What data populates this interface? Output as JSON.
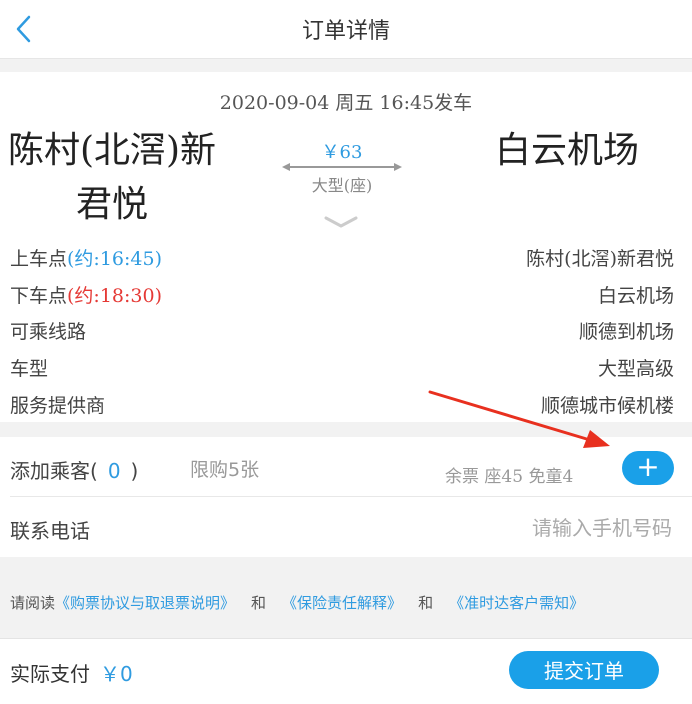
{
  "header": {
    "title": "订单详情"
  },
  "trip": {
    "departure": "2020-09-04 周五 16:45发车",
    "from": "陈村(北滘)新君悦",
    "to": "白云机场",
    "price": "￥63",
    "bus_type": "大型(座)"
  },
  "details": [
    {
      "label": "上车点",
      "note": "(约:16:45)",
      "value": "陈村(北滘)新君悦"
    },
    {
      "label": "下车点",
      "note": "(约:18:30)",
      "value": "白云机场"
    },
    {
      "label": "可乘线路",
      "value": "顺德到机场"
    },
    {
      "label": "车型",
      "value": "大型高级"
    },
    {
      "label": "服务提供商",
      "value": "顺德城市候机楼"
    }
  ],
  "passengers": {
    "label_open": "添加乘客(",
    "count": "0",
    "label_close": ")",
    "limit": "限购5张",
    "remaining": "余票 座45 免童4",
    "add_symbol": "+"
  },
  "contact": {
    "label": "联系电话",
    "placeholder": "请输入手机号码"
  },
  "agreement": {
    "prefix": "请阅读",
    "link1": "《购票协议与取退票说明》",
    "and": "和",
    "link2": "《保险责任解释》",
    "link3": "《准时达客户需知》"
  },
  "footer": {
    "pay_label": "实际支付",
    "amount": "￥0",
    "submit_label": "提交订单"
  },
  "colors": {
    "accent": "#1aa0e8",
    "link": "#2f9be0",
    "dropoff": "#e53935",
    "annotation": "#e8301f"
  }
}
